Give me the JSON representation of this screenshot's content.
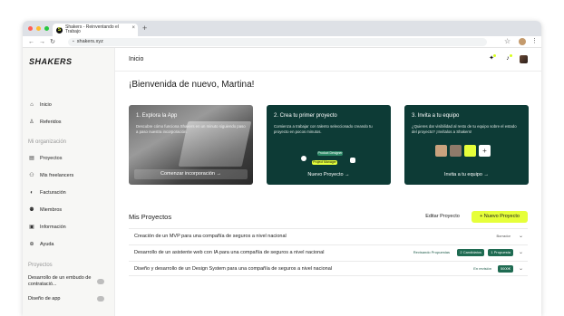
{
  "browser": {
    "tab_title": "Shakers - Reinventando el Trabajo",
    "tab_favicon": "S",
    "url": "shakers.xyz",
    "icons": {
      "back": "←",
      "forward": "→",
      "reload": "↻",
      "lock": "🔒",
      "star": "☆",
      "menu": "⋮",
      "new_tab": "+",
      "close": "×"
    }
  },
  "colors": {
    "accent": "#e6ff3a",
    "card_green": "#0d3b36",
    "sidebar_bg": "#f7f7f5"
  },
  "sidebar": {
    "logo": "SHAKERS",
    "items": [
      {
        "label": "Inicio",
        "icon": "home-icon",
        "glyph": "⌂"
      },
      {
        "label": "Referidos",
        "icon": "user-icon",
        "glyph": "♙"
      }
    ],
    "org_heading": "Mi organización",
    "org_items": [
      {
        "label": "Proyectos",
        "icon": "briefcase-icon",
        "glyph": "▤"
      },
      {
        "label": "Mis freelancers",
        "icon": "people-icon",
        "glyph": "⚇"
      },
      {
        "label": "Facturación",
        "icon": "billing-icon",
        "glyph": "◐"
      },
      {
        "label": "Miembros",
        "icon": "members-icon",
        "glyph": "⚉"
      },
      {
        "label": "Información",
        "icon": "info-icon",
        "glyph": "▣"
      },
      {
        "label": "Ayuda",
        "icon": "help-icon",
        "glyph": "⊕"
      }
    ],
    "projects_heading": "Proyectos",
    "projects": [
      {
        "label": "Desarrollo de un embudo de contratació..."
      },
      {
        "label": "Diseño de app"
      }
    ]
  },
  "header": {
    "title": "Inicio"
  },
  "welcome": "¡Bienvenida de nuevo, Martina!",
  "cards": [
    {
      "title": "1. Explora la App",
      "desc": "Descubre cómo funciona Shakers en un minuto siguiendo paso a paso nuestra incorporación.",
      "cta": "Comenzar incorporación  →"
    },
    {
      "title": "2. Crea tu primer proyecto",
      "desc": "Comienza a trabajar con talento seleccionado creando tu proyecto en pocos minutos.",
      "cta": "Nuevo Proyecto  →",
      "mini_labels": [
        "Product Designer",
        "Project Manager"
      ]
    },
    {
      "title": "3. Invita a tu equipo",
      "desc": "¿Quieres dar visibilidad al resto de tu equipo sobre el estado del proyecto? ¡Invítalos a Shakers!",
      "cta": "Invita a tu equipo  →"
    }
  ],
  "projects_section": {
    "title": "Mis Proyectos",
    "edit_label": "Editar Proyecto",
    "new_label": "+   Nuevo Proyecto",
    "rows": [
      {
        "name": "Creación de un MVP para una compañía de seguros a nivel nacional",
        "chips": [
          "Borrador"
        ]
      },
      {
        "name": "Desarrollo de un asistente web con IA para una compañía de seguros a nivel nacional",
        "chips": [
          "Revisando Propuestas",
          "2 Candidatos",
          "1 Propuesta"
        ]
      },
      {
        "name": "Diseño y desarrollo de un Design System para una compañía de seguros a nivel nacional",
        "chips": [
          "En revisión",
          "5000€"
        ]
      }
    ]
  }
}
